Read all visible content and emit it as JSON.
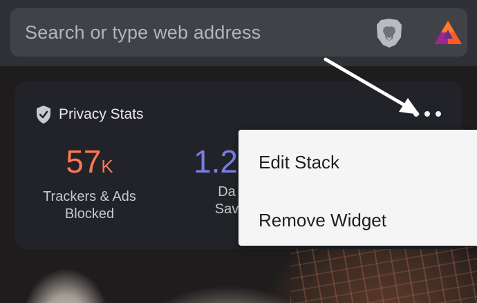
{
  "search": {
    "placeholder": "Search or type web address"
  },
  "icons": {
    "brave": "brave-lion-shield-icon",
    "rewards": "bat-triangle-icon",
    "privacy": "shield-check-icon",
    "more": "more-horizontal-icon"
  },
  "widget": {
    "title": "Privacy Stats",
    "stats": [
      {
        "value": "57",
        "unit": "K",
        "label_line1": "Trackers & Ads",
        "label_line2": "Blocked",
        "color": "#ff7755"
      },
      {
        "value": "1.2",
        "unit": "",
        "label_line1": "Da",
        "label_line2": "Sav",
        "color": "#7a7ee8"
      }
    ]
  },
  "menu": {
    "items": [
      "Edit Stack",
      "Remove Widget"
    ]
  },
  "colors": {
    "accent_orange": "#ff7755",
    "accent_purple": "#7a7ee8",
    "card_bg": "#222328",
    "menu_bg": "#f5f5f6"
  }
}
